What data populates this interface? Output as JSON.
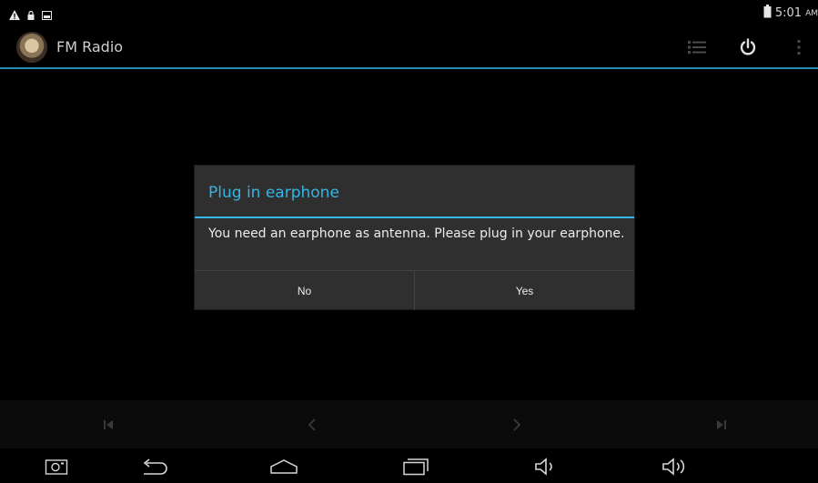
{
  "status_bar": {
    "time": "5:01",
    "ampm": "AM",
    "icons": [
      "warning-icon",
      "lock-icon",
      "image-icon",
      "battery-icon"
    ]
  },
  "action_bar": {
    "title": "FM Radio",
    "icons": [
      "list-icon",
      "power-icon",
      "overflow-menu-icon"
    ]
  },
  "dialog": {
    "title": "Plug in earphone",
    "message": "You need an earphone as antenna. Please plug in your earphone.",
    "buttons": {
      "no": "No",
      "yes": "Yes"
    }
  },
  "transport_bar": {
    "icons": [
      "skip-previous-icon",
      "seek-back-icon",
      "seek-forward-icon",
      "skip-next-icon"
    ]
  },
  "nav_bar": {
    "icons": [
      "screenshot-icon",
      "back-icon",
      "home-icon",
      "recent-apps-icon",
      "volume-down-icon",
      "volume-up-icon"
    ]
  },
  "colors": {
    "accent": "#33b5e5",
    "dialog_bg": "#2f2f2f",
    "background": "#000000"
  }
}
